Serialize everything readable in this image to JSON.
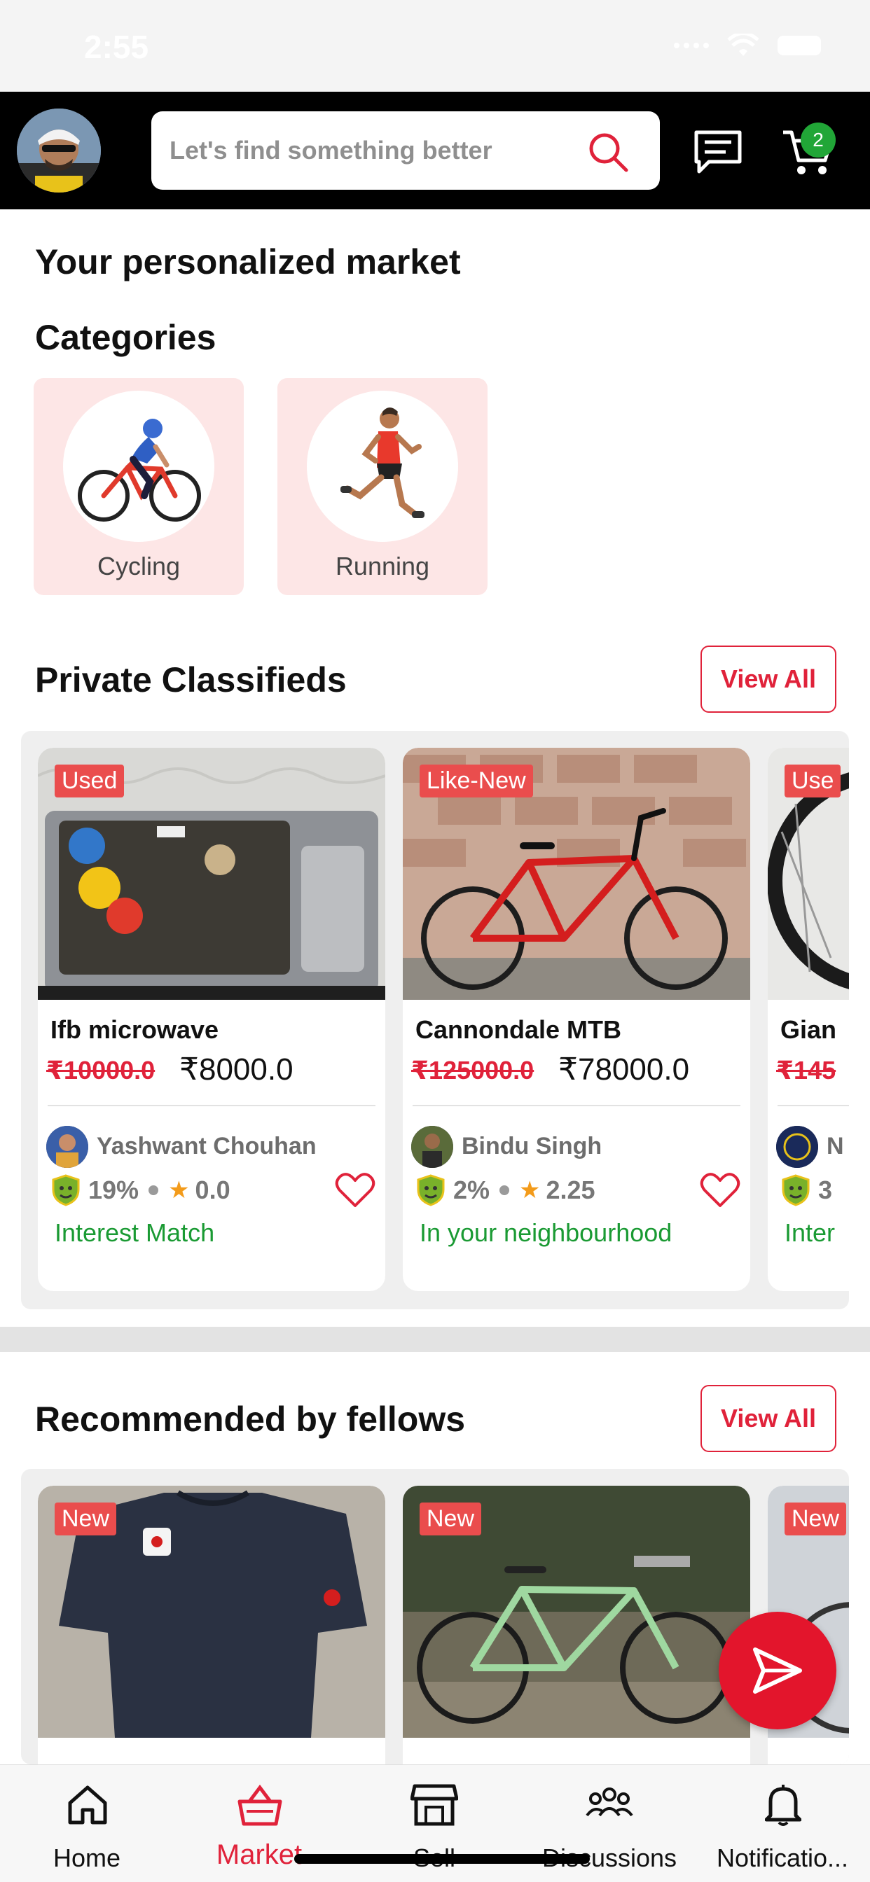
{
  "status_bar": {
    "time": "2:55"
  },
  "header": {
    "search_placeholder": "Let's find something better",
    "cart_count": "2",
    "icons": [
      "search-icon",
      "chat-icon",
      "cart-icon"
    ]
  },
  "market": {
    "title": "Your personalized market",
    "categories_title": "Categories",
    "categories": [
      {
        "label": "Cycling",
        "icon": "cyclist-icon"
      },
      {
        "label": "Running",
        "icon": "runner-icon"
      }
    ]
  },
  "private_classifieds": {
    "title": "Private Classifieds",
    "view_all": "View All",
    "items": [
      {
        "condition": "Used",
        "title": "Ifb microwave",
        "old_price": "₹10000.0",
        "price": "₹8000.0",
        "seller": "Yashwant Chouhan",
        "match_pct": "19%",
        "rating": "0.0",
        "tag": "Interest Match"
      },
      {
        "condition": "Like-New",
        "title": "Cannondale MTB",
        "old_price": "₹125000.0",
        "price": "₹78000.0",
        "seller": "Bindu Singh",
        "match_pct": "2%",
        "rating": "2.25",
        "tag": "In your neighbourhood"
      },
      {
        "condition": "Use",
        "title": "Gian",
        "old_price": "₹145",
        "seller": "N",
        "match_pct": "3",
        "tag": "Inter"
      }
    ]
  },
  "recommended": {
    "title": "Recommended by fellows",
    "view_all": "View All",
    "items": [
      {
        "condition": "New"
      },
      {
        "condition": "New"
      },
      {
        "condition": "New"
      }
    ]
  },
  "colors": {
    "accent": "#e0223a",
    "green": "#1a9a33",
    "badge": "#ea4d4d"
  },
  "bottom_nav": [
    {
      "label": "Home",
      "icon": "home-icon"
    },
    {
      "label": "Market",
      "icon": "basket-icon",
      "active": true
    },
    {
      "label": "Sell",
      "icon": "store-icon"
    },
    {
      "label": "Discussions",
      "icon": "people-icon"
    },
    {
      "label": "Notificatio...",
      "icon": "bell-icon"
    }
  ]
}
